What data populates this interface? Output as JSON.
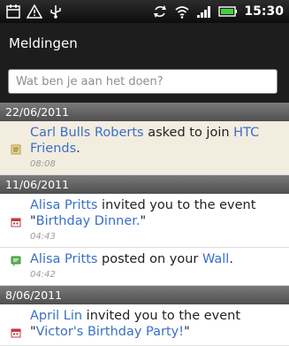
{
  "status_bar": {
    "time": "15:30",
    "left_icons": [
      "calendar-icon",
      "warning-icon",
      "usb-icon"
    ],
    "right_icons": [
      "sync-icon",
      "wifi-icon",
      "signal-icon",
      "battery-icon"
    ]
  },
  "header": {
    "title": "Meldingen",
    "search_placeholder": "Wat ben je aan het doen?"
  },
  "sections": [
    {
      "date": "22/06/2011",
      "items": [
        {
          "icon": "htc-friends-icon",
          "name": "Carl Bulls Roberts",
          "text": " asked to join ",
          "link": "HTC Friends",
          "after": ".",
          "time": "08:08"
        }
      ]
    },
    {
      "date": "11/06/2011",
      "items": [
        {
          "icon": "event-icon",
          "name": "Alisa Pritts",
          "text": " invited you to the event \"",
          "link": "Birthday Dinner.",
          "after": "\"",
          "time": "04:43"
        },
        {
          "icon": "wall-post-icon",
          "name": "Alisa Pritts",
          "text": " posted on your ",
          "link": "Wall",
          "after": ".",
          "time": "04:42"
        }
      ]
    },
    {
      "date": "8/06/2011",
      "items": [
        {
          "icon": "event-icon",
          "name": "April Lin",
          "text": " invited you to the event \"",
          "link": "Victor's Birthday Party!",
          "after": "\""
        }
      ]
    }
  ]
}
